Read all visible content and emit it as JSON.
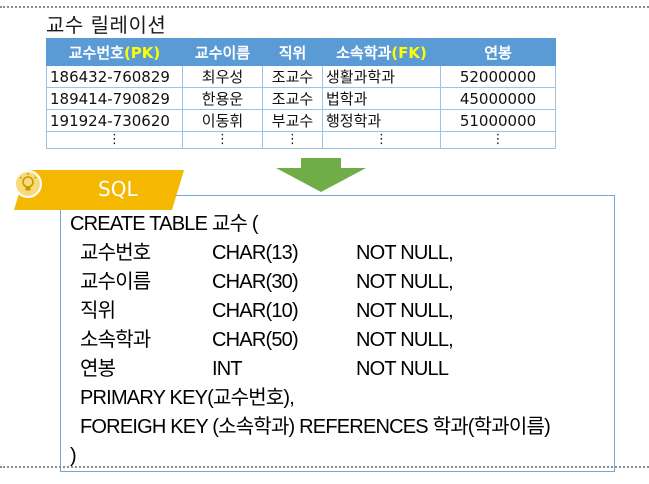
{
  "title": "교수 릴레이션",
  "table": {
    "headers": [
      {
        "text": "교수번호",
        "key": "(PK)"
      },
      {
        "text": "교수이름",
        "key": ""
      },
      {
        "text": "직위",
        "key": ""
      },
      {
        "text": "소속학과",
        "key": "(FK)"
      },
      {
        "text": "연봉",
        "key": ""
      }
    ],
    "rows": [
      [
        "186432-760829",
        "최우성",
        "조교수",
        "생활과학과",
        "52000000"
      ],
      [
        "189414-790829",
        "한용운",
        "조교수",
        "법학과",
        "45000000"
      ],
      [
        "191924-730620",
        "이동휘",
        "부교수",
        "행정학과",
        "51000000"
      ]
    ],
    "ellipsis": "⋮"
  },
  "sql": {
    "label": "SQL",
    "create_line": "CREATE TABLE 교수 (",
    "columns": [
      {
        "name": "교수번호",
        "type": "CHAR(13)",
        "constraint": "NOT NULL,"
      },
      {
        "name": "교수이름",
        "type": "CHAR(30)",
        "constraint": "NOT NULL,"
      },
      {
        "name": "직위",
        "type": "CHAR(10)",
        "constraint": "NOT NULL,"
      },
      {
        "name": "소속학과",
        "type": "CHAR(50)",
        "constraint": "NOT NULL,"
      },
      {
        "name": "연봉",
        "type": "INT",
        "constraint": "NOT NULL"
      }
    ],
    "primary_key": "PRIMARY KEY(교수번호),",
    "foreign_key": "FOREIGH KEY (소속학과) REFERENCES 학과(학과이름)",
    "close": ")"
  },
  "colors": {
    "header_bg": "#5b9bd5",
    "key_text": "#ffff00",
    "arrow": "#70ad47",
    "tab": "#f5b800",
    "box_border": "#6fa8dc"
  },
  "icons": {
    "tab_icon": "lightbulb-icon",
    "arrow": "down-arrow-icon"
  }
}
